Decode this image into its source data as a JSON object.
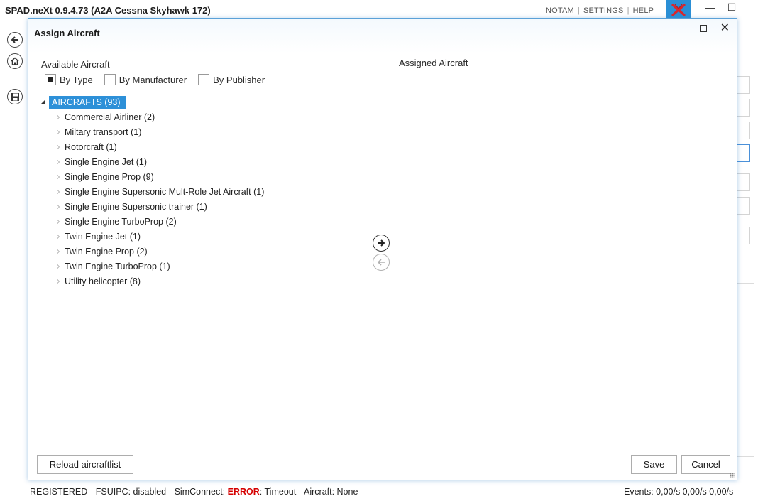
{
  "window": {
    "title": "SPAD.neXt 0.9.4.73  (A2A Cessna Skyhawk 172)",
    "top_links": [
      "NOTAM",
      "SETTINGS",
      "HELP"
    ],
    "minimize_glyph": "—",
    "maximize_glyph": "☐",
    "accent": "#2a8fd6"
  },
  "dialog": {
    "title": "Assign Aircraft",
    "close_glyph": "✕",
    "available_label": "Available Aircraft",
    "assigned_label": "Assigned Aircraft",
    "group_options": [
      {
        "label": "By Type",
        "checked": true
      },
      {
        "label": "By Manufacturer",
        "checked": false
      },
      {
        "label": "By Publisher",
        "checked": false
      }
    ],
    "tree": {
      "root_label": "AIRCRAFTS (93)",
      "items": [
        "Commercial Airliner (2)",
        "Miltary transport (1)",
        "Rotorcraft (1)",
        "Single Engine Jet (1)",
        "Single Engine Prop (9)",
        "Single Engine Supersonic Mult-Role Jet Aircraft (1)",
        "Single Engine Supersonic trainer (1)",
        "Single Engine TurboProp (2)",
        "Twin Engine Jet (1)",
        "Twin Engine Prop (2)",
        "Twin Engine TurboProp (1)",
        "Utility helicopter (8)"
      ]
    },
    "buttons": {
      "reload": "Reload aircraftlist",
      "save": "Save",
      "cancel": "Cancel"
    }
  },
  "status_bar": {
    "registered": "REGISTERED",
    "fsuipc": "FSUIPC: disabled",
    "simconnect_prefix": "SimConnect: ",
    "simconnect_error": "ERROR",
    "simconnect_suffix": ": Timeout",
    "aircraft": "Aircraft: None",
    "events": "Events: 0,00/s 0,00/s 0,00/s",
    "error_color": "#d50000"
  }
}
